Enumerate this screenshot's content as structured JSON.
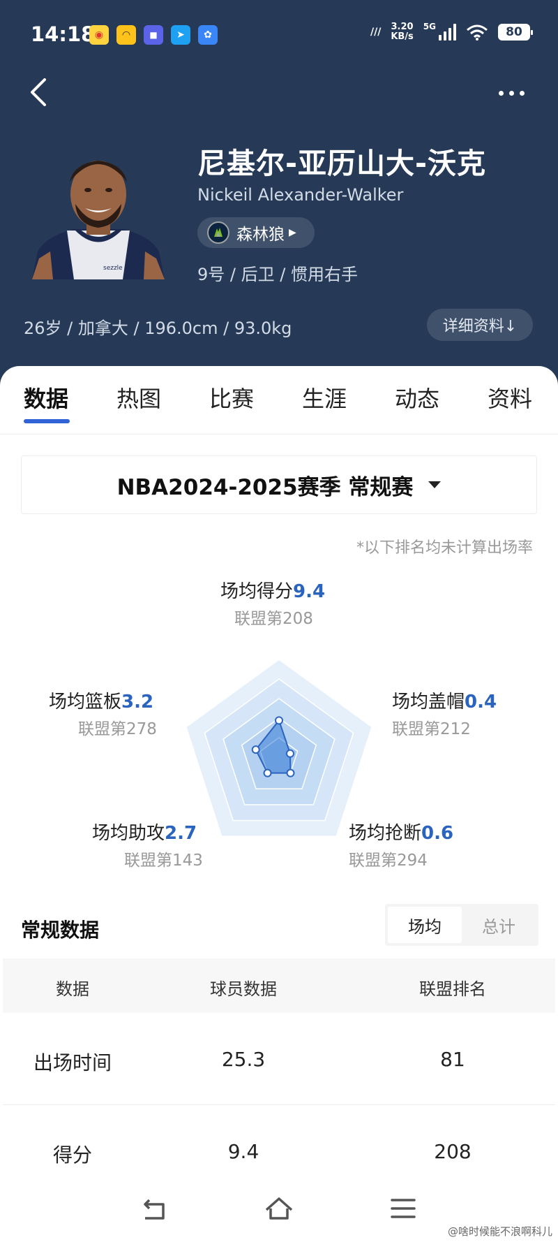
{
  "status_bar": {
    "time": "14:18",
    "net_speed_top": "3.20",
    "net_speed_bottom": "KB/s",
    "network_type": "5G",
    "battery": "80"
  },
  "player": {
    "name_cn": "尼基尔-亚历山大-沃克",
    "name_en": "Nickeil Alexander-Walker",
    "team": "森林狼",
    "position_info": "9号 / 后卫 / 惯用右手",
    "bio": "26岁 / 加拿大 / 196.0cm / 93.0kg",
    "detail_button": "详细资料↓",
    "jersey_sponsor": "sezzle"
  },
  "tabs": [
    "数据",
    "热图",
    "比赛",
    "生涯",
    "动态",
    "资料"
  ],
  "active_tab": 0,
  "season": {
    "label": "NBA2024-2025赛季 常规赛"
  },
  "note": "*以下排名均未计算出场率",
  "radar": {
    "scale_max": 25,
    "axes": [
      {
        "label": "场均得分",
        "value": "9.4",
        "rank": "联盟第208",
        "fraction": 0.376
      },
      {
        "label": "场均盖帽",
        "value": "0.4",
        "rank": "联盟第212",
        "fraction": 0.12
      },
      {
        "label": "场均抢断",
        "value": "0.6",
        "rank": "联盟第294",
        "fraction": 0.2
      },
      {
        "label": "场均助攻",
        "value": "2.7",
        "rank": "联盟第143",
        "fraction": 0.2
      },
      {
        "label": "场均篮板",
        "value": "3.2",
        "rank": "联盟第278",
        "fraction": 0.25
      }
    ]
  },
  "regular_stats": {
    "title": "常规数据",
    "segments": [
      "场均",
      "总计"
    ],
    "headers": [
      "数据",
      "球员数据",
      "联盟排名"
    ],
    "rows": [
      [
        "出场时间",
        "25.3",
        "81"
      ],
      [
        "得分",
        "9.4",
        "208"
      ]
    ]
  },
  "watermark": "@啥时候能不浪啊科儿",
  "colors": {
    "header_bg": "#263a57",
    "accent_blue": "#2f63d6",
    "value_blue": "#2b64bf"
  }
}
